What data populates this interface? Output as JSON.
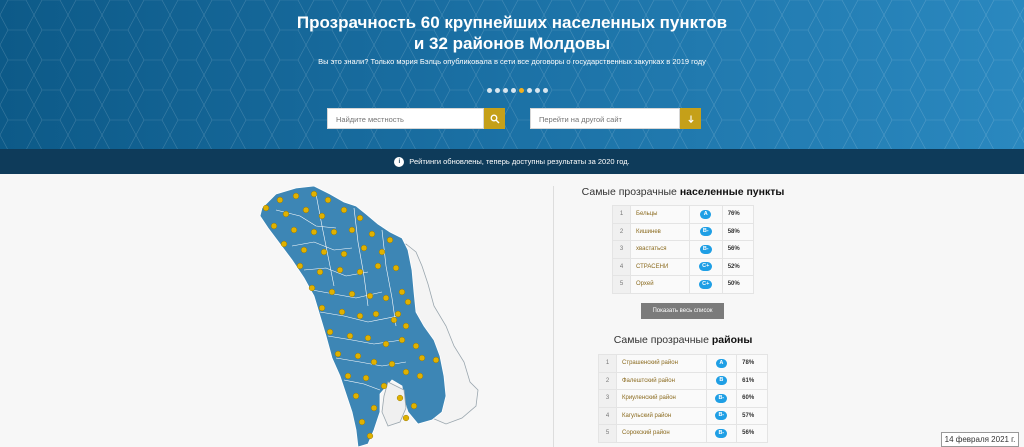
{
  "hero": {
    "title_line1": "Прозрачность 60 крупнейших населенных пунктов",
    "title_line2": "и 32 районов Молдовы",
    "subtitle": "Вы это знали? Только мэрия Бэлць опубликовала в сети все договоры о государственных закупках в 2019 году",
    "carousel_total": 8,
    "carousel_active": 5,
    "search_placeholder": "Найдите местность",
    "goto_placeholder": "Перейти на другой сайт"
  },
  "notice": {
    "badge": "i",
    "text": "Рейтинги обновлены, теперь доступны результаты за 2020 год."
  },
  "localities": {
    "title_prefix": "Самые прозрачные ",
    "title_bold": "населенные пункты",
    "rows": [
      {
        "num": "1",
        "name": "Бельцы",
        "grade": "A",
        "pct": "76%"
      },
      {
        "num": "2",
        "name": "Кишинев",
        "grade": "B-",
        "pct": "58%"
      },
      {
        "num": "3",
        "name": "хвастаться",
        "grade": "B-",
        "pct": "56%"
      },
      {
        "num": "4",
        "name": "СТРАСЕНИ",
        "grade": "C+",
        "pct": "52%"
      },
      {
        "num": "5",
        "name": "Орхей",
        "grade": "C+",
        "pct": "50%"
      }
    ],
    "show_all": "Показать весь список"
  },
  "districts": {
    "title_prefix": "Самые прозрачные ",
    "title_bold": "районы",
    "rows": [
      {
        "num": "1",
        "name": "Страшенский район",
        "grade": "A",
        "pct": "78%"
      },
      {
        "num": "2",
        "name": "Фалештский район",
        "grade": "B",
        "pct": "61%"
      },
      {
        "num": "3",
        "name": "Криуленский район",
        "grade": "B-",
        "pct": "60%"
      },
      {
        "num": "4",
        "name": "Кагульский район",
        "grade": "B-",
        "pct": "57%"
      },
      {
        "num": "5",
        "name": "Сорокский район",
        "grade": "B-",
        "pct": "56%"
      }
    ]
  },
  "colors": {
    "accent": "#c5a019",
    "grade_pill": "#1f9fe5",
    "map_fill": "#3d86b5",
    "map_marker": "#e0b100"
  },
  "icons": {
    "search": "search-icon",
    "goto": "arrow-down-icon",
    "notice": "info-icon"
  },
  "overlay": {
    "date": "14 февраля 2021 г."
  }
}
